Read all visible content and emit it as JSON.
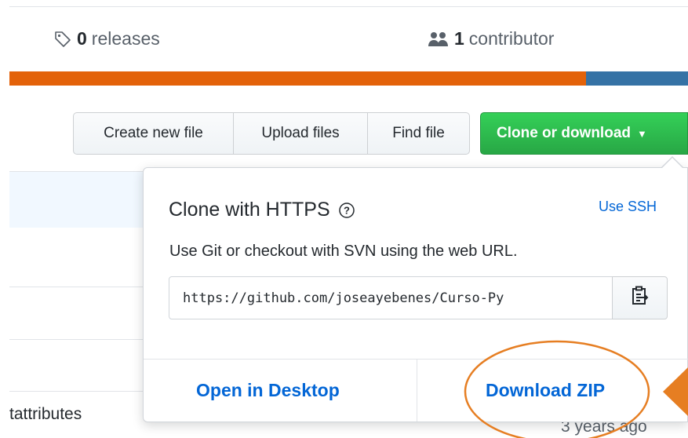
{
  "summary": {
    "releases_count": "0",
    "releases_label": "releases",
    "contributors_count": "1",
    "contributors_label": "contributor"
  },
  "language_bar": {
    "colors": [
      "#e36209",
      "#3572a5"
    ],
    "fractions": [
      0.85,
      0.15
    ]
  },
  "toolbar": {
    "create_new_file": "Create new file",
    "upload_files": "Upload files",
    "find_file": "Find file",
    "clone_or_download": "Clone or download",
    "clone_color": "#28a745"
  },
  "background_list": {
    "file_name": "tattributes",
    "last_updated": "3 years ago"
  },
  "clone_popover": {
    "title": "Clone with HTTPS",
    "use_ssh": "Use SSH",
    "description": "Use Git or checkout with SVN using the web URL.",
    "url": "https://github.com/joseayebenes/Curso-Py",
    "open_in_desktop": "Open in Desktop",
    "download_zip": "Download ZIP"
  },
  "annotation": {
    "color": "#e67e22",
    "highlight": "circle around Download ZIP with arrow pointing to it"
  },
  "icons": {
    "releases": "tag-icon",
    "contributors": "people-icon",
    "help": "question-icon",
    "copy": "clipboard-icon",
    "dropdown": "caret-down-icon"
  }
}
